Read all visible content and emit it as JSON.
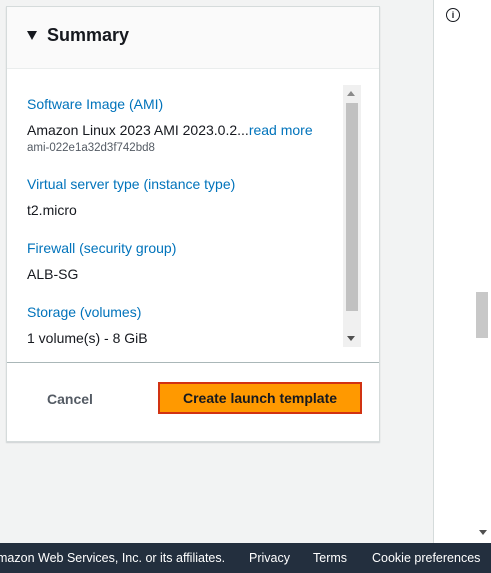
{
  "summary": {
    "title": "Summary",
    "fields": [
      {
        "label": "Software Image (AMI)",
        "value": "Amazon Linux 2023 AMI 2023.0.2...",
        "link": "read more",
        "sub": "ami-022e1a32d3f742bd8"
      },
      {
        "label": "Virtual server type (instance type)",
        "value": "t2.micro"
      },
      {
        "label": "Firewall (security group)",
        "value": "ALB-SG"
      },
      {
        "label": "Storage (volumes)",
        "value": "1 volume(s) - 8 GiB"
      }
    ],
    "cancel_label": "Cancel",
    "create_label": "Create launch template"
  },
  "footer": {
    "copyright": "mazon Web Services, Inc. or its affiliates.",
    "links": [
      "Privacy",
      "Terms",
      "Cookie preferences"
    ]
  },
  "help_icon": "info-icon",
  "colors": {
    "accent": "#ff9900",
    "link": "#0073bb",
    "footer_bg": "#232f3e",
    "focus_border": "#d13212"
  }
}
